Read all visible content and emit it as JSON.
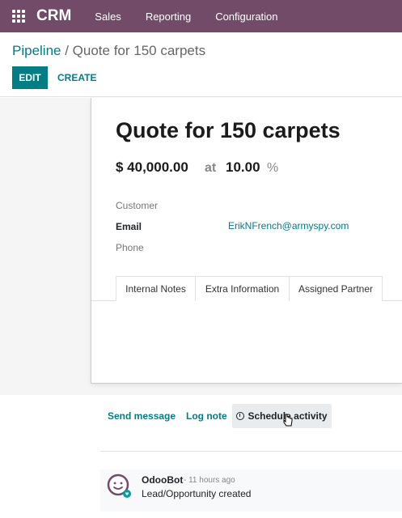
{
  "navbar": {
    "app_name": "CRM",
    "menu": [
      "Sales",
      "Reporting",
      "Configuration"
    ],
    "color": "#714b67"
  },
  "breadcrumb": {
    "parent": "Pipeline",
    "separator": " / ",
    "current": "Quote for 150 carpets"
  },
  "buttons": {
    "edit": "EDIT",
    "create": "CREATE"
  },
  "record": {
    "title": "Quote for 150 carpets",
    "expected_revenue": "$ 40,000.00",
    "at_label": "at",
    "probability": "10.00",
    "percent_sign": "%",
    "fields": {
      "customer_label": "Customer",
      "email_label": "Email",
      "email_value": "ErikNFrench@armyspy.com",
      "phone_label": "Phone"
    },
    "tabs": [
      "Internal Notes",
      "Extra Information",
      "Assigned Partner"
    ],
    "active_tab": "Internal Notes"
  },
  "chatter": {
    "send_message": "Send message",
    "log_note": "Log note",
    "schedule_activity": "Schedule activity",
    "messages": [
      {
        "author": "OdooBot",
        "timestamp": "- 11 hours ago",
        "body": "Lead/Opportunity created"
      }
    ]
  },
  "colors": {
    "accent": "#017e84",
    "brand": "#714b67"
  },
  "icons": {
    "apps": "apps-grid-icon",
    "clock": "clock-icon",
    "avatar": "odoobot-avatar-icon",
    "cursor": "mouse-cursor-icon"
  }
}
